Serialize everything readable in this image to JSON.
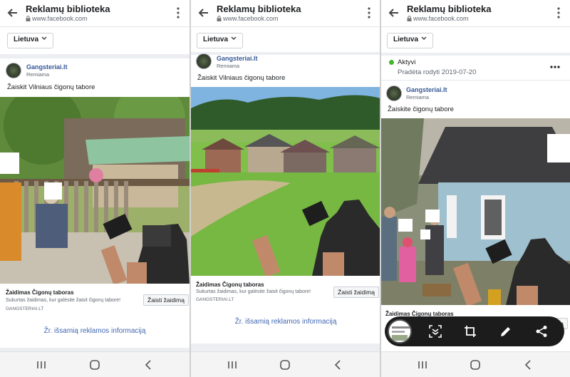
{
  "app": {
    "title": "Reklamų biblioteka",
    "url": "www.facebook.com",
    "country_filter": "Lietuva"
  },
  "ads": [
    {
      "page_name": "Gangsteriai.lt",
      "sponsored_label": "Remiama",
      "text": "Žaiskit Vilniaus čigonų tabore",
      "cta_title": "Žaidimas Čigonų taboras",
      "cta_description": "Sukurtas žaidimas, kur galėsite žaisit čigonų tabore!",
      "cta_domain": "GANGSTERIAI.LT",
      "cta_button": "Žaisti žaidimą",
      "details_link": "Žr. išsamią reklamos informaciją"
    },
    {
      "page_name": "Gangsteriai.lt",
      "sponsored_label": "Remiama",
      "text": "Žaiskit Vilniaus čigonų tabore",
      "cta_title": "Žaidimas Čigonų taboras",
      "cta_description": "Sukurtas žaidimas, kur galėsite žaisit čigonų tabore!",
      "cta_domain": "GANGSTERIAI.LT",
      "cta_button": "Žaisti žaidimą",
      "details_link": "Žr. išsamią reklamos informaciją"
    },
    {
      "status": "Aktyvi",
      "started": "Pradėta rodyti 2019-07-20",
      "page_name": "Gangsteriai.lt",
      "sponsored_label": "Remiama",
      "text": "Žaiskite čigonų tabore",
      "cta_title": "Žaidimas Čigonų taboras",
      "cta_button": "Žaisti žaidimą"
    }
  ],
  "icons": {
    "back": "back-arrow-icon",
    "menu": "kebab-menu-icon",
    "lock": "lock-icon",
    "chevron": "chevron-down-icon",
    "more": "more-horizontal-icon",
    "recents": "recent-apps-icon",
    "home": "home-icon",
    "nav_back": "nav-back-icon",
    "scroll_capture": "scroll-capture-icon",
    "crop": "crop-icon",
    "draw": "draw-icon",
    "share": "share-icon"
  },
  "colors": {
    "link": "#385898",
    "details_link": "#4267b2",
    "active_dot": "#42b72a",
    "toolbar_bg": "#1c1c1c"
  }
}
